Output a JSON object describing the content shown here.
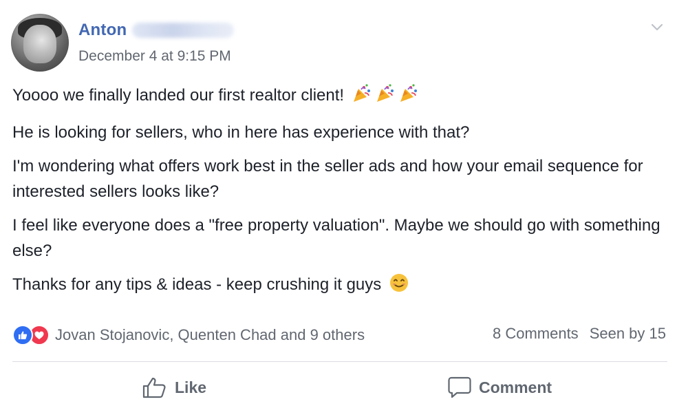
{
  "post": {
    "author_first_name": "Anton",
    "timestamp": "December 4 at 9:15 PM",
    "paragraphs": [
      "Yoooo we finally landed our first realtor client!",
      "He is looking for sellers, who in here has experience with that?",
      "I'm wondering what offers work best in the seller ads and how your email sequence for interested sellers looks like?",
      "I feel like everyone does a \"free property valuation\". Maybe we should go with something else?",
      "Thanks for any tips & ideas - keep crushing it guys"
    ],
    "emoji": {
      "first_paragraph": [
        "party-popper-icon",
        "party-popper-icon",
        "party-popper-icon"
      ],
      "last_paragraph": "smiling-face-icon"
    }
  },
  "engagement": {
    "reaction_types": [
      "like",
      "love"
    ],
    "reactors_text": "Jovan Stojanovic, Quenten Chad and 9 others",
    "comments_text": "8 Comments",
    "seen_text": "Seen by 15"
  },
  "actions": {
    "like_label": "Like",
    "comment_label": "Comment"
  },
  "colors": {
    "author_name": "#4267b2",
    "like_reaction": "#2f6ef3",
    "love_reaction": "#f0384f",
    "secondary_text": "#616770"
  }
}
